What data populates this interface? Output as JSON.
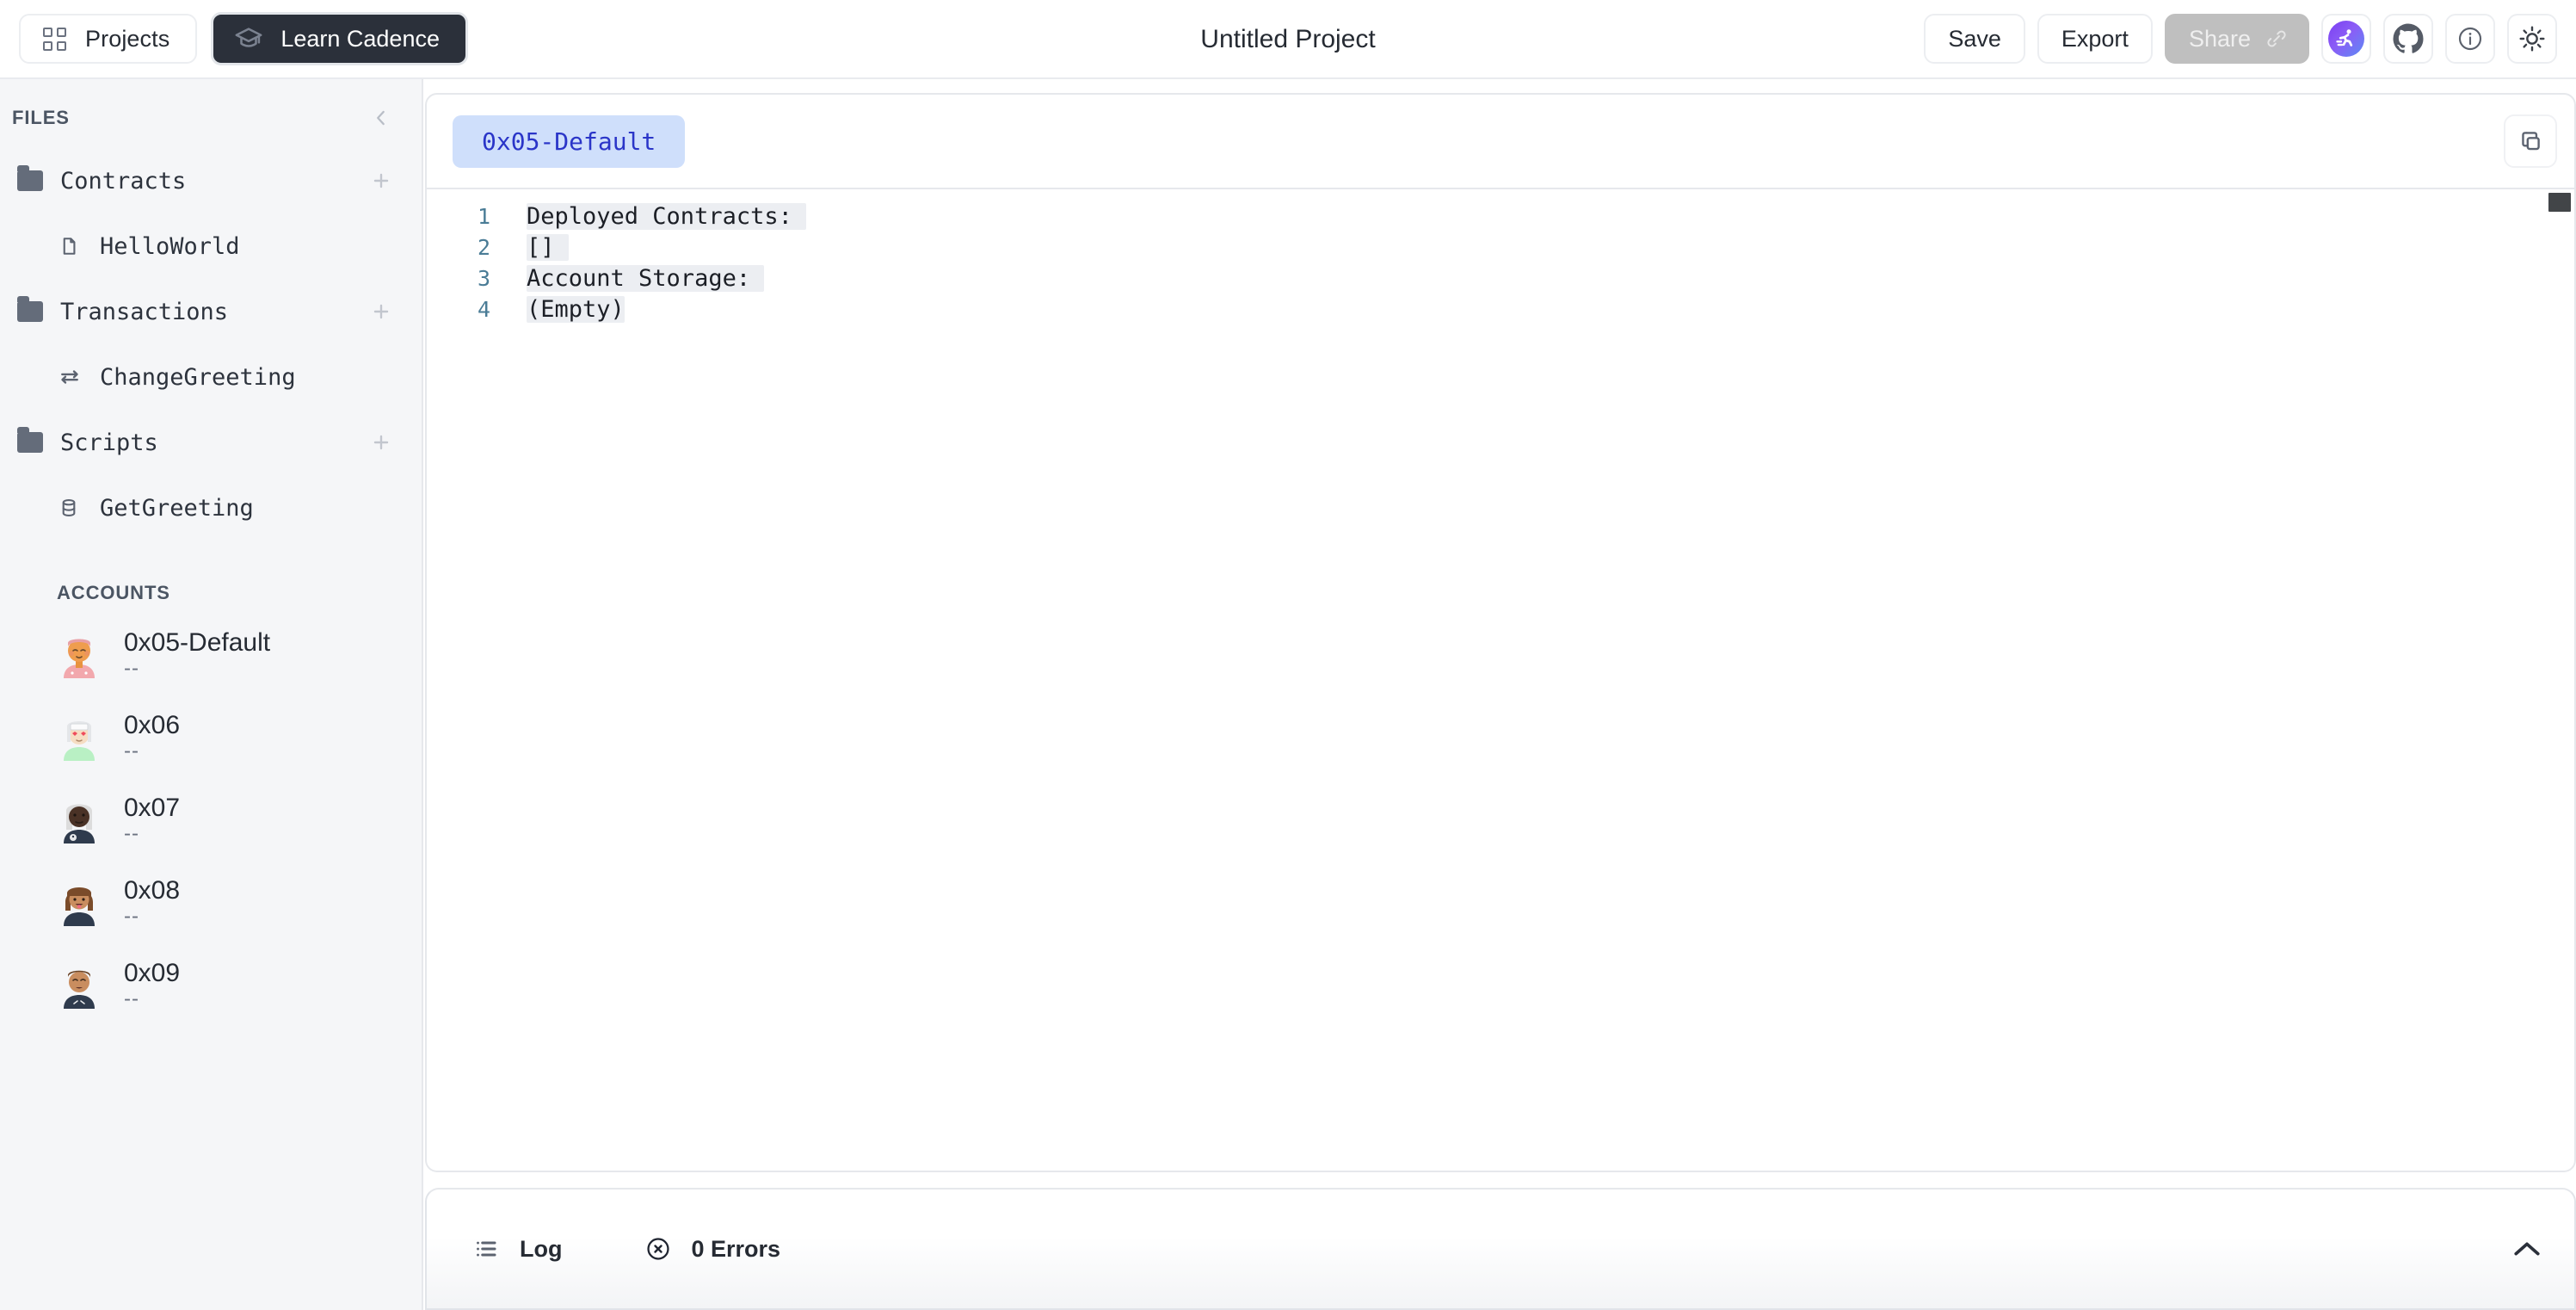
{
  "header": {
    "projects_label": "Projects",
    "learn_label": "Learn Cadence",
    "title": "Untitled Project",
    "save_label": "Save",
    "export_label": "Export",
    "share_label": "Share"
  },
  "sidebar": {
    "files_caption": "FILES",
    "tree": [
      {
        "label": "Contracts",
        "icon": "folder-icon",
        "kind": "folder",
        "add": "+"
      },
      {
        "label": "HelloWorld",
        "icon": "contract-file-icon",
        "kind": "file"
      },
      {
        "label": "Transactions",
        "icon": "folder-icon",
        "kind": "folder",
        "add": "+"
      },
      {
        "label": "ChangeGreeting",
        "icon": "transaction-icon",
        "kind": "file"
      },
      {
        "label": "Scripts",
        "icon": "folder-icon",
        "kind": "folder",
        "add": "+"
      },
      {
        "label": "GetGreeting",
        "icon": "script-database-icon",
        "kind": "file"
      }
    ],
    "accounts_caption": "ACCOUNTS",
    "accounts": [
      {
        "name": "0x05-Default",
        "sub": "--"
      },
      {
        "name": "0x06",
        "sub": "--"
      },
      {
        "name": "0x07",
        "sub": "--"
      },
      {
        "name": "0x08",
        "sub": "--"
      },
      {
        "name": "0x09",
        "sub": "--"
      }
    ]
  },
  "editor": {
    "tab_label": "0x05-Default",
    "lines": [
      {
        "no": "1",
        "text": "Deployed Contracts: "
      },
      {
        "no": "2",
        "text": "[] "
      },
      {
        "no": "3",
        "text": "Account Storage: "
      },
      {
        "no": "4",
        "text": "(Empty)"
      }
    ]
  },
  "bottom": {
    "log_label": "Log",
    "errors_label": "0 Errors"
  },
  "colors": {
    "accent_tab_bg": "#cfdffb",
    "accent_tab_text": "#2a35c8",
    "learn_bg": "#2b303a",
    "share_bg": "#bfbfbf",
    "sidebar_bg": "#f5f6f8",
    "runner_gradient_start": "#7b3ff2",
    "runner_gradient_end": "#5d8bf4"
  }
}
